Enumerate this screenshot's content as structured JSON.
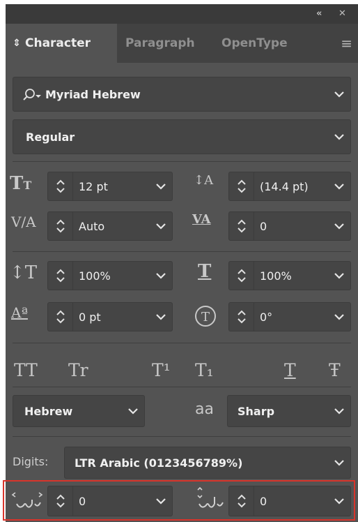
{
  "window": {
    "collapse_icon": "double-chevron-left-icon",
    "close_icon": "close-icon"
  },
  "tabs": [
    {
      "label": "Character",
      "active": true,
      "icon": "up-down-arrows-icon"
    },
    {
      "label": "Paragraph",
      "active": false
    },
    {
      "label": "OpenType",
      "active": false
    }
  ],
  "panel_menu_icon": "hamburger-menu-icon",
  "font": {
    "family": "Myriad Hebrew",
    "style": "Regular"
  },
  "fields": {
    "font_size": "12 pt",
    "leading": "(14.4 pt)",
    "kerning": "Auto",
    "tracking": "0",
    "vertical_scale": "100%",
    "horizontal_scale": "100%",
    "baseline_shift": "0 pt",
    "rotation": "0°"
  },
  "language": "Hebrew",
  "anti_alias_glyph": "aa",
  "anti_alias": "Sharp",
  "digits": {
    "label": "Digits:",
    "value": "LTR Arabic (0123456789%)"
  },
  "kashida": {
    "value_1": "0",
    "value_2": "0"
  },
  "style_buttons": [
    "TT",
    "Tr",
    "T¹",
    "T₁",
    "T",
    "Ŧ"
  ],
  "colors": {
    "panel_bg": "#535353",
    "field_bg": "#454545",
    "tab_bar": "#424242",
    "highlight": "#d9342b"
  }
}
